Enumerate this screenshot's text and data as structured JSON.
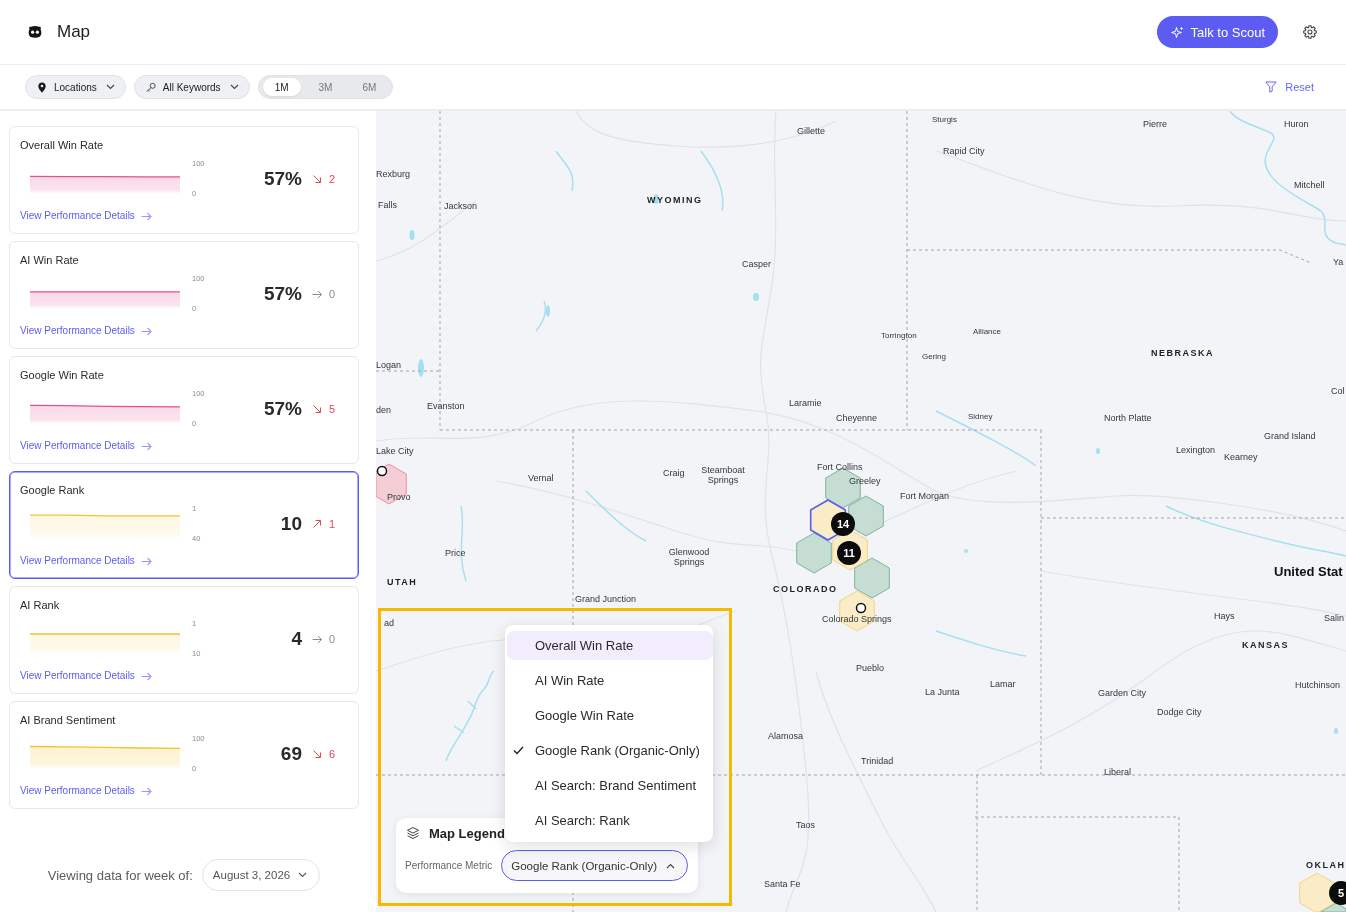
{
  "header": {
    "title": "Map",
    "assistant_button": "Talk to Scout"
  },
  "filters": {
    "dropdowns": [
      {
        "label": "Locations",
        "kind": "location"
      },
      {
        "label": "All Keywords",
        "kind": "keyword"
      }
    ],
    "periods": [
      {
        "label": "1M",
        "selected": true
      },
      {
        "label": "3M",
        "selected": false
      },
      {
        "label": "6M",
        "selected": false
      }
    ],
    "reset": "Reset"
  },
  "metrics": [
    {
      "title": "Overall Win Rate",
      "selected": false,
      "value": "57%",
      "delta": {
        "kind": "down",
        "value": "2",
        "color": "#e5484d"
      },
      "link": "View Performance Details",
      "chart_data": {
        "type": "area",
        "ylim": [
          0,
          100
        ],
        "yticks": [
          100,
          0
        ],
        "series": [
          {
            "color": "#e2538c",
            "values": [
              59,
              58,
              58,
              57,
              57
            ]
          }
        ]
      }
    },
    {
      "title": "AI Win Rate",
      "selected": false,
      "value": "57%",
      "delta": {
        "kind": "flat",
        "value": "0",
        "color": "#8a8d93"
      },
      "link": "View Performance Details",
      "chart_data": {
        "type": "area",
        "ylim": [
          0,
          100
        ],
        "yticks": [
          100,
          0
        ],
        "series": [
          {
            "color": "#e2538c",
            "values": [
              57,
              57,
              57,
              57,
              57
            ]
          }
        ]
      }
    },
    {
      "title": "Google Win Rate",
      "selected": false,
      "value": "57%",
      "delta": {
        "kind": "down",
        "value": "5",
        "color": "#e5484d"
      },
      "link": "View Performance Details",
      "chart_data": {
        "type": "area",
        "ylim": [
          0,
          100
        ],
        "yticks": [
          100,
          0
        ],
        "series": [
          {
            "color": "#e2538c",
            "values": [
              62,
              61,
              59,
              58,
              57
            ]
          }
        ]
      }
    },
    {
      "title": "Google Rank",
      "selected": true,
      "value": "10",
      "delta": {
        "kind": "up",
        "value": "1",
        "color": "#e5484d"
      },
      "link": "View Performance Details",
      "chart_data": {
        "type": "line",
        "ylim": [
          40,
          1
        ],
        "yticks": [
          1,
          40
        ],
        "series": [
          {
            "color": "#f2c230",
            "values": [
              9,
              9,
              10,
              10,
              10
            ]
          }
        ]
      }
    },
    {
      "title": "AI Rank",
      "selected": false,
      "value": "4",
      "delta": {
        "kind": "flat",
        "value": "0",
        "color": "#8a8d93"
      },
      "link": "View Performance Details",
      "chart_data": {
        "type": "line",
        "ylim": [
          10,
          1
        ],
        "yticks": [
          1,
          10
        ],
        "series": [
          {
            "color": "#f2c230",
            "values": [
              4,
              4,
              4,
              4,
              4
            ]
          }
        ]
      }
    },
    {
      "title": "AI Brand Sentiment",
      "selected": false,
      "value": "69",
      "delta": {
        "kind": "down",
        "value": "6",
        "color": "#e5484d"
      },
      "link": "View Performance Details",
      "chart_data": {
        "type": "area",
        "ylim": [
          0,
          100
        ],
        "yticks": [
          100,
          0
        ],
        "series": [
          {
            "color": "#f2c230",
            "values": [
              75,
              74,
              72,
              70,
              69
            ]
          }
        ]
      }
    }
  ],
  "week_selector": {
    "label": "Viewing data for week of:",
    "value": "August 3, 2026"
  },
  "map": {
    "labels": [
      {
        "text": "Gillette",
        "kind": "city"
      },
      {
        "text": "Sturgis",
        "kind": "town"
      },
      {
        "text": "Rapid City",
        "kind": "city"
      },
      {
        "text": "Pierre",
        "kind": "city"
      },
      {
        "text": "Huron",
        "kind": "city"
      },
      {
        "text": "Rexburg",
        "kind": "city"
      },
      {
        "text": "Falls",
        "kind": "city"
      },
      {
        "text": "Jackson",
        "kind": "city"
      },
      {
        "text": "WYOMING",
        "kind": "state"
      },
      {
        "text": "Mitchell",
        "kind": "city"
      },
      {
        "text": "Casper",
        "kind": "city"
      },
      {
        "text": "Ya",
        "kind": "city"
      },
      {
        "text": "Torrington",
        "kind": "town"
      },
      {
        "text": "Alliance",
        "kind": "town"
      },
      {
        "text": "Gering",
        "kind": "town"
      },
      {
        "text": "NEBRASKA",
        "kind": "state"
      },
      {
        "text": "Logan",
        "kind": "city"
      },
      {
        "text": "Evanston",
        "kind": "city"
      },
      {
        "text": "den",
        "kind": "city"
      },
      {
        "text": "Laramie",
        "kind": "city"
      },
      {
        "text": "Cheyenne",
        "kind": "city"
      },
      {
        "text": "Sidney",
        "kind": "town"
      },
      {
        "text": "North Platte",
        "kind": "city"
      },
      {
        "text": "Col",
        "kind": "city"
      },
      {
        "text": "Grand Island",
        "kind": "city"
      },
      {
        "text": "Lexington",
        "kind": "city"
      },
      {
        "text": "Kearney",
        "kind": "city"
      },
      {
        "text": "Lake City",
        "kind": "city"
      },
      {
        "text": "Vernal",
        "kind": "city"
      },
      {
        "text": "Craig",
        "kind": "city"
      },
      {
        "text": "Steamboat Springs",
        "kind": "city"
      },
      {
        "text": "Fort Collins",
        "kind": "city"
      },
      {
        "text": "Greeley",
        "kind": "city"
      },
      {
        "text": "Fort Morgan",
        "kind": "city"
      },
      {
        "text": "Provo",
        "kind": "city"
      },
      {
        "text": "Price",
        "kind": "city"
      },
      {
        "text": "Glenwood Springs",
        "kind": "city"
      },
      {
        "text": "UTAH",
        "kind": "state"
      },
      {
        "text": "COLORADO",
        "kind": "state"
      },
      {
        "text": "Grand Junction",
        "kind": "city"
      },
      {
        "text": "United Stat",
        "kind": "country"
      },
      {
        "text": "Colorado Springs",
        "kind": "city"
      },
      {
        "text": "Hays",
        "kind": "city"
      },
      {
        "text": "Salin",
        "kind": "city"
      },
      {
        "text": "KANSAS",
        "kind": "state"
      },
      {
        "text": "Pueblo",
        "kind": "city"
      },
      {
        "text": "La Junta",
        "kind": "city"
      },
      {
        "text": "Lamar",
        "kind": "city"
      },
      {
        "text": "Garden City",
        "kind": "city"
      },
      {
        "text": "Hutchinson",
        "kind": "city"
      },
      {
        "text": "Dodge City",
        "kind": "city"
      },
      {
        "text": "Alamosa",
        "kind": "city"
      },
      {
        "text": "Trinidad",
        "kind": "city"
      },
      {
        "text": "Liberal",
        "kind": "city"
      },
      {
        "text": "Taos",
        "kind": "city"
      },
      {
        "text": "Santa Fe",
        "kind": "city"
      },
      {
        "text": "OKLAH",
        "kind": "state"
      },
      {
        "text": "ad",
        "kind": "city"
      }
    ],
    "hexes": [
      {
        "color": "#c5ddd3",
        "selected": false
      },
      {
        "color": "#c5ddd3",
        "selected": false
      },
      {
        "color": "#c5ddd3",
        "selected": false
      },
      {
        "color": "#c5ddd3",
        "selected": false
      },
      {
        "color": "#f9ecc6",
        "selected": false
      },
      {
        "color": "#f9ecc6",
        "selected": false,
        "count": "11"
      },
      {
        "color": "#f9ecc6",
        "selected": true,
        "count": "14"
      },
      {
        "color": "#f5cdd5",
        "selected": false
      },
      {
        "color": "#c5ddd3",
        "selected": false
      },
      {
        "color": "#f9ecc6",
        "selected": false,
        "count": "5"
      }
    ],
    "legend": {
      "title": "Map Legend",
      "metric_label": "Performance Metric",
      "metric_value": "Google Rank (Organic-Only)",
      "expanded": true,
      "options": [
        {
          "label": "Overall Win Rate",
          "selected": false,
          "highlighted": true
        },
        {
          "label": "AI Win Rate",
          "selected": false,
          "highlighted": false
        },
        {
          "label": "Google Win Rate",
          "selected": false,
          "highlighted": false
        },
        {
          "label": "Google Rank (Organic-Only)",
          "selected": true,
          "highlighted": false
        },
        {
          "label": "AI Search: Brand Sentiment",
          "selected": false,
          "highlighted": false
        },
        {
          "label": "AI Search: Rank",
          "selected": false,
          "highlighted": false
        }
      ]
    }
  }
}
